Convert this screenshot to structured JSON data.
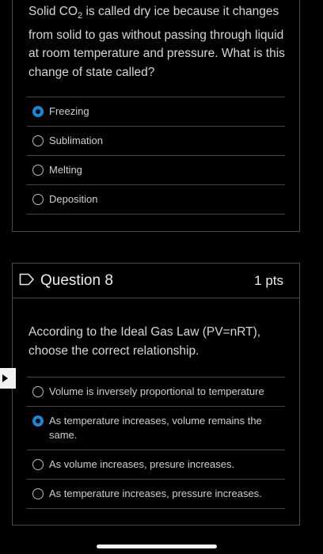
{
  "question_7": {
    "text_before": "Solid CO",
    "subscript": "2",
    "text_after": " is called dry ice because it changes from solid to gas without passing through liquid at room temperature and pressure. What is this change of state called?",
    "answers": [
      {
        "label": "Freezing",
        "selected": true
      },
      {
        "label": "Sublimation",
        "selected": false
      },
      {
        "label": "Melting",
        "selected": false
      },
      {
        "label": "Deposition",
        "selected": false
      }
    ]
  },
  "question_8": {
    "title": "Question 8",
    "points": "1 pts",
    "text": "According to the Ideal Gas Law (PV=nRT), choose the correct relationship.",
    "answers": [
      {
        "label": "Volume is inversely proportional to temperature",
        "selected": false
      },
      {
        "label": "As temperature increases, volume remains the same.",
        "selected": true
      },
      {
        "label": "As volume increases, presure increases.",
        "selected": false
      },
      {
        "label": "As temperature increases, pressure increases.",
        "selected": false
      }
    ]
  },
  "colors": {
    "accent": "#1a86d6",
    "background": "#000000",
    "border": "#4a4a4a"
  },
  "icons": {
    "flag": "flag-outline-icon",
    "side_arrow": "triangle-right-icon"
  }
}
